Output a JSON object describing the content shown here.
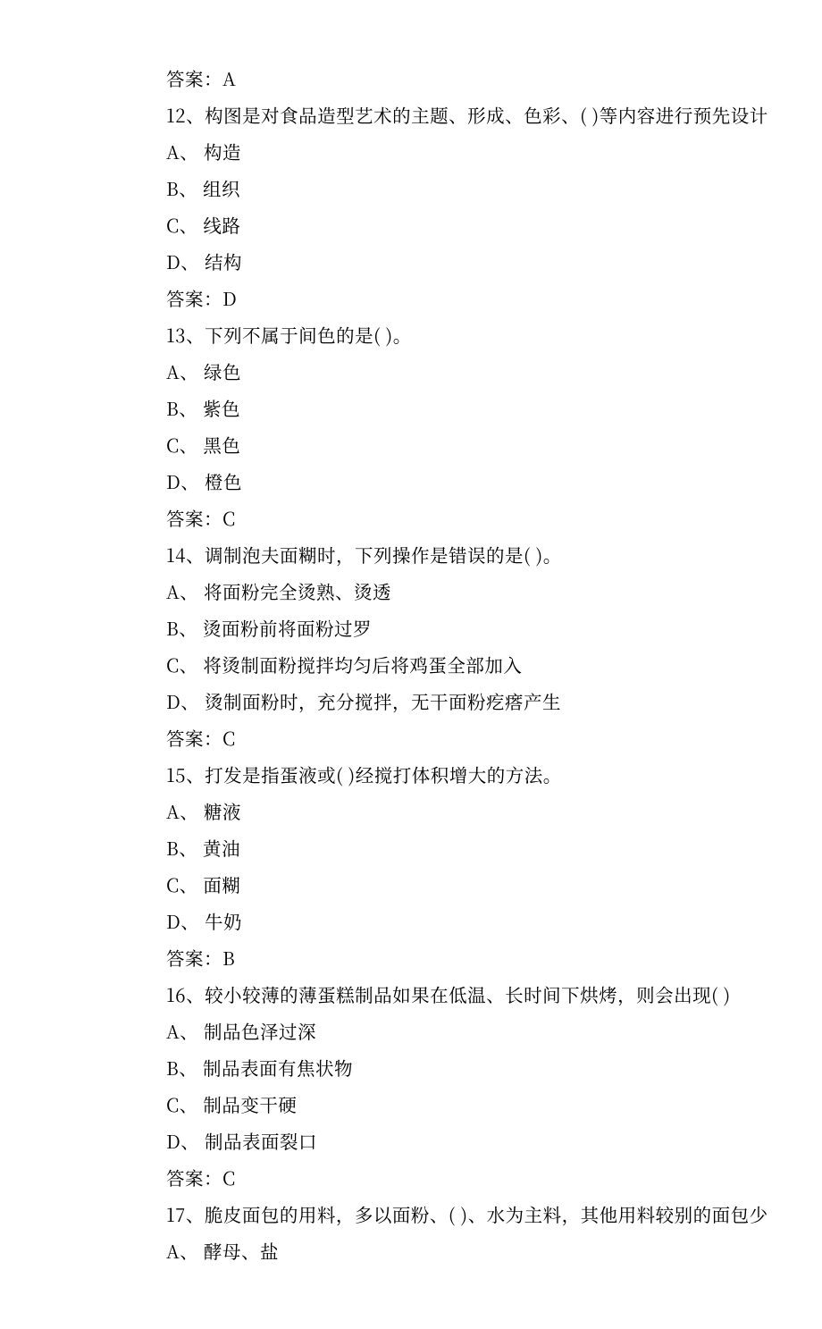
{
  "lines": [
    "答案：A",
    "12、构图是对食品造型艺术的主题、形成、色彩、( )等内容进行预先设计",
    "A、 构造",
    "B、 组织",
    "C、 线路",
    "D、 结构",
    "答案：D",
    "13、下列不属于间色的是( )。",
    "A、 绿色",
    "B、 紫色",
    "C、 黑色",
    "D、 橙色",
    "答案：C",
    "14、调制泡夫面糊时，下列操作是错误的是( )。",
    "A、 将面粉完全烫熟、烫透",
    "B、 烫面粉前将面粉过罗",
    "C、 将烫制面粉搅拌均匀后将鸡蛋全部加入",
    "D、 烫制面粉时，充分搅拌，无干面粉疙瘩产生",
    "答案：C",
    "15、打发是指蛋液或( )经搅打体积增大的方法。",
    "A、 糖液",
    "B、 黄油",
    "C、 面糊",
    "D、 牛奶",
    "答案：B",
    "16、较小较薄的薄蛋糕制品如果在低温、长时间下烘烤，则会出现( )",
    "A、 制品色泽过深",
    "B、 制品表面有焦状物",
    "C、 制品变干硬",
    "D、 制品表面裂口",
    "答案：C",
    "17、脆皮面包的用料，多以面粉、( )、水为主料，其他用料较别的面包少",
    "A、 酵母、盐"
  ]
}
